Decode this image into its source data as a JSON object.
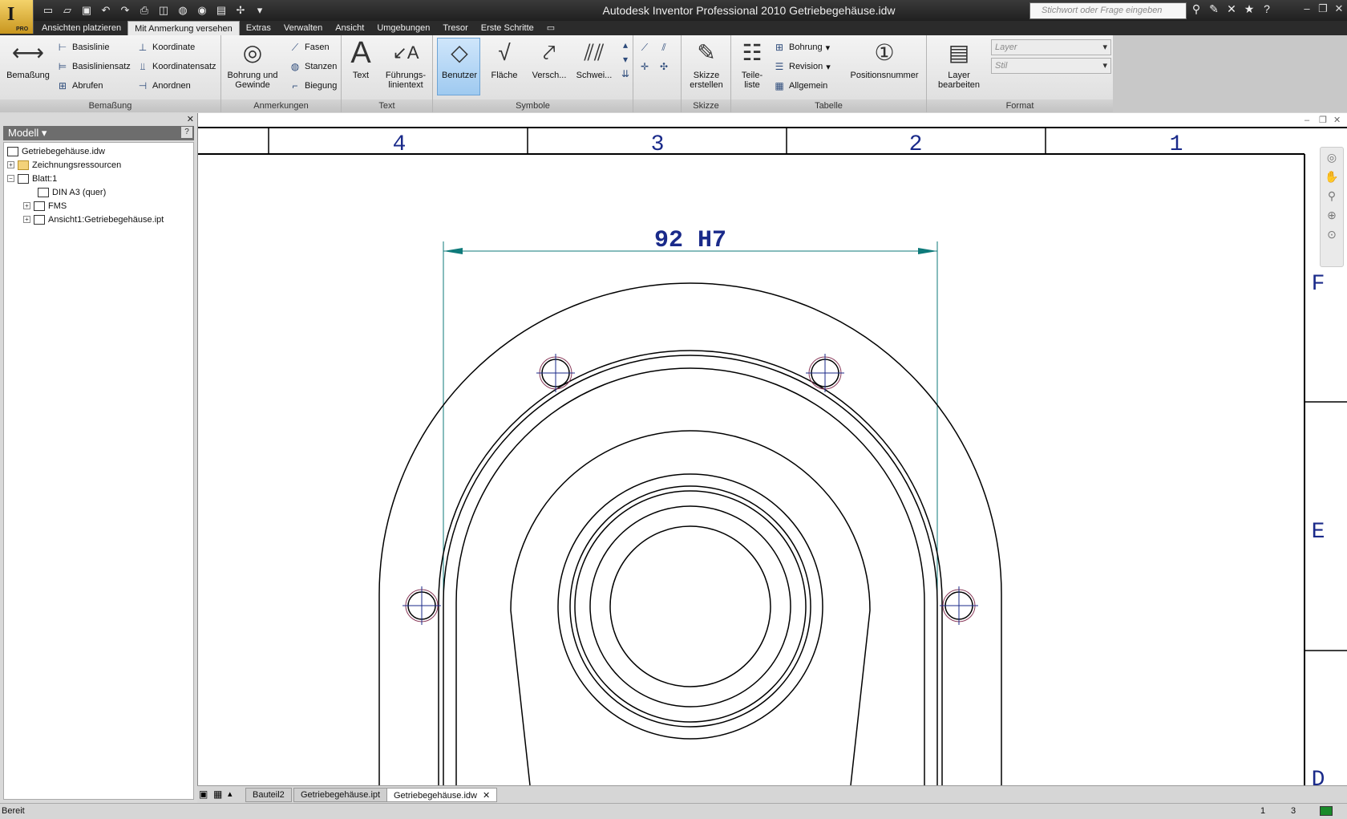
{
  "titlebar": {
    "title": "Autodesk Inventor Professional 2010    Getriebegehäuse.idw",
    "search_placeholder": "Stichwort oder Frage eingeben",
    "app_badge": "PRO"
  },
  "tabs": [
    {
      "label": "Ansichten platzieren"
    },
    {
      "label": "Mit Anmerkung versehen"
    },
    {
      "label": "Extras"
    },
    {
      "label": "Verwalten"
    },
    {
      "label": "Ansicht"
    },
    {
      "label": "Umgebungen"
    },
    {
      "label": "Tresor"
    },
    {
      "label": "Erste Schritte"
    }
  ],
  "ribbon": {
    "bemassung": {
      "label": "Bemaßung",
      "big": "Bemaßung",
      "basislinie": "Basislinie",
      "basisliniensatz": "Basisliniensatz",
      "abrufen": "Abrufen",
      "koordinate": "Koordinate",
      "koordinatensatz": "Koordinatensatz",
      "anordnen": "Anordnen"
    },
    "anmerkungen": {
      "label": "Anmerkungen",
      "bohrung_l1": "Bohrung und",
      "bohrung_l2": "Gewinde",
      "fasen": "Fasen",
      "stanzen": "Stanzen",
      "biegung": "Biegung"
    },
    "text": {
      "label": "Text",
      "text": "Text",
      "fuehrung_l1": "Führungs-",
      "fuehrung_l2": "linientext"
    },
    "symbole": {
      "label": "Symbole",
      "benutzer": "Benutzer",
      "flaeche": "Fläche",
      "versch": "Versch...",
      "schwei": "Schwei..."
    },
    "skizze": {
      "label": "Skizze",
      "l1": "Skizze",
      "l2": "erstellen"
    },
    "tabelle": {
      "label": "Tabelle",
      "teile_l1": "Teile-",
      "teile_l2": "liste",
      "bohrung": "Bohrung",
      "revision": "Revision",
      "allgemein": "Allgemein",
      "positionsnummer": "Positionsnummer"
    },
    "format": {
      "label": "Format",
      "layer_l1": "Layer",
      "layer_l2": "bearbeiten",
      "layer_dropdown": "Layer",
      "stil_dropdown": "Stil"
    }
  },
  "browser": {
    "header": "Modell",
    "items": [
      {
        "label": "Getriebegehäuse.idw"
      },
      {
        "label": "Zeichnungsressourcen"
      },
      {
        "label": "Blatt:1"
      },
      {
        "label": "DIN A3 (quer)"
      },
      {
        "label": "FMS"
      },
      {
        "label": "Ansicht1:Getriebegehäuse.ipt"
      }
    ]
  },
  "drawing": {
    "dimension_text": "92 H7",
    "zone_columns": [
      "4",
      "3",
      "2",
      "1"
    ],
    "zone_rows": [
      "F",
      "E",
      "D"
    ]
  },
  "doc_tabs": [
    {
      "label": "Bauteil2"
    },
    {
      "label": "Getriebegehäuse.ipt"
    },
    {
      "label": "Getriebegehäuse.idw"
    }
  ],
  "status": {
    "text": "Bereit",
    "value1": "1",
    "value2": "3"
  },
  "colors": {
    "drawing_line": "#000000",
    "dimension": "#0e7a7a",
    "zone_text": "#1a2a8a"
  }
}
